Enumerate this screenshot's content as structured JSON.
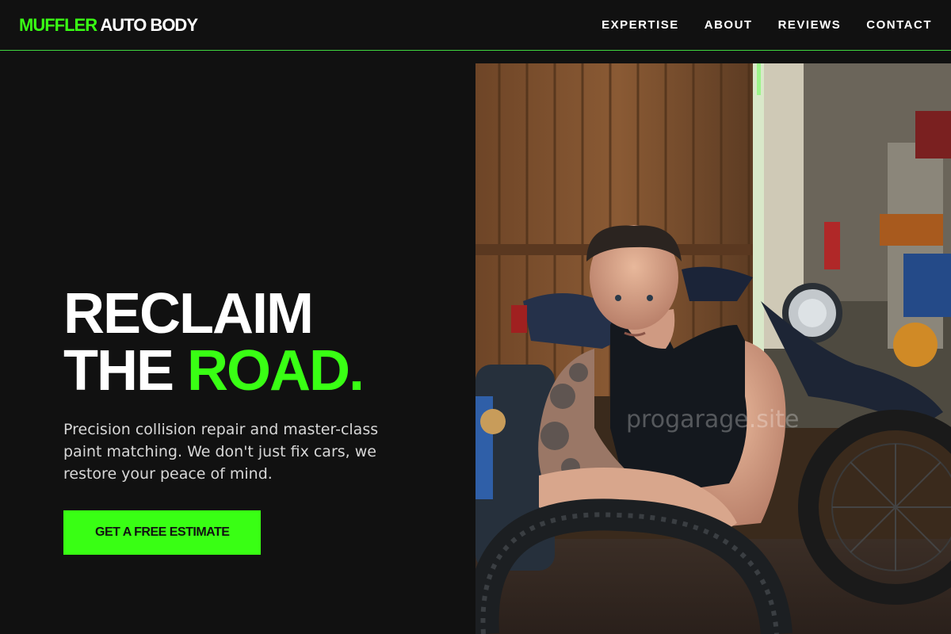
{
  "header": {
    "logo_accent": "MUFFLER",
    "logo_main": "AUTO BODY",
    "nav": [
      "EXPERTISE",
      "ABOUT",
      "REVIEWS",
      "CONTACT"
    ]
  },
  "hero": {
    "headline_line1": "RECLAIM",
    "headline_line2_prefix": "THE ",
    "headline_line2_accent": "ROAD.",
    "subtitle": "Precision collision repair and master-class paint matching. We don't just fix cars, we restore your peace of mind.",
    "cta_label": "GET A FREE ESTIMATE",
    "image_watermark": "progarage.site"
  },
  "colors": {
    "accent": "#39ff14",
    "background": "#111111",
    "text": "#ffffff",
    "subtext": "#d7d7d7"
  },
  "icons": {
    "hero_image": "mechanic-with-motorcycle-photo"
  }
}
